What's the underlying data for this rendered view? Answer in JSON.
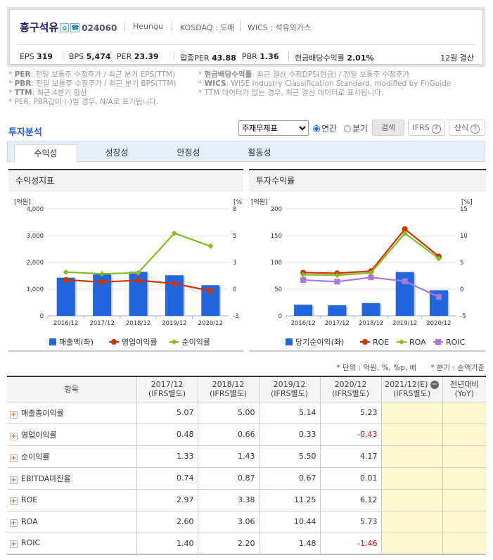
{
  "company": {
    "name": "흥구석유",
    "code": "024060",
    "eng": "Heungu",
    "market": "KOSDAQ : 도매",
    "wics": "WICS : 석유와가스",
    "icons": [
      "home-icon",
      "ir-icon"
    ]
  },
  "stats": [
    {
      "k": "EPS",
      "v": "319"
    },
    {
      "k": "BPS",
      "v": "5,474"
    },
    {
      "k": "PER",
      "v": "23.39"
    },
    {
      "k": "업종PER",
      "v": "43.88"
    },
    {
      "k": "PBR",
      "v": "1.36"
    },
    {
      "k": "현금배당수익률",
      "v": "2.01%"
    }
  ],
  "settle": "12월 결산",
  "notes_left": [
    {
      "k": "PER",
      "t": ": 전일 보통주 수정주가 / 최근 분기 EPS(TTM)"
    },
    {
      "k": "PBR",
      "t": ": 전일 보통주 수정주가 / 최근 분기 BPS(TTM)"
    },
    {
      "k": "TTM",
      "t": ": 최근 4분기 합산"
    },
    {
      "k": "",
      "t": "PER, PBR값이 (-)일 경우, N/A로 표기됩니다."
    }
  ],
  "notes_right": [
    {
      "k": "현금배당수익률",
      "t": ": 최근 결산 수정DPS(현금) / 전일 보통주 수정주가"
    },
    {
      "k": "WICS",
      "t": ": WISE Industry Classification Standard, modified by FnGuide"
    },
    {
      "k": "",
      "t": "TTM 데이터가 없는 경우, 최근 결산 데이터로 표시됩니다."
    }
  ],
  "section_title": "투자분석",
  "controls": {
    "select": "주재무제표",
    "annual": "연간",
    "quarter": "분기",
    "search": "검색",
    "ifrs": "IFRS",
    "formula": "산식",
    "q": "?"
  },
  "tabs": [
    "수익성",
    "성장성",
    "안정성",
    "활동성"
  ],
  "chart_data": [
    {
      "type": "bar+line",
      "title": "수익성지표",
      "left_unit": "[억원]",
      "right_unit": "[%]",
      "categories": [
        "2016/12",
        "2017/12",
        "2018/12",
        "2019/12",
        "2020/12"
      ],
      "ylim_left": [
        0,
        4000
      ],
      "left_ticks": [
        "0",
        "1,000",
        "2,000",
        "3,000",
        "4,000"
      ],
      "ylim_right": [
        -3,
        8
      ],
      "right_ticks": [
        "-3",
        "0",
        "3",
        "5",
        "8"
      ],
      "bars": {
        "name": "매출액(좌)",
        "color": "#2266dd",
        "values": [
          1430,
          1550,
          1650,
          1520,
          1150
        ]
      },
      "lines": [
        {
          "name": "영업이익률",
          "color": "#cc3300",
          "marker": "circle",
          "values": [
            0.7,
            0.48,
            0.66,
            0.33,
            -0.43
          ]
        },
        {
          "name": "순이익률",
          "color": "#88bb22",
          "marker": "diamond",
          "values": [
            1.5,
            1.33,
            1.43,
            5.5,
            4.17
          ]
        }
      ]
    },
    {
      "type": "bar+line",
      "title": "투자수익률",
      "left_unit": "[억원]",
      "right_unit": "[%]",
      "categories": [
        "2016/12",
        "2017/12",
        "2018/12",
        "2019/12",
        "2020/12"
      ],
      "ylim_left": [
        0,
        200
      ],
      "left_ticks": [
        "0",
        "50",
        "100",
        "150",
        "200"
      ],
      "ylim_right": [
        -5,
        15
      ],
      "right_ticks": [
        "-5",
        "0",
        "5",
        "10",
        "15"
      ],
      "bars": {
        "name": "당기순이익(좌)",
        "color": "#2266dd",
        "values": [
          21,
          20,
          24,
          82,
          48
        ]
      },
      "lines": [
        {
          "name": "ROE",
          "color": "#cc3300",
          "marker": "circle",
          "values": [
            3.1,
            2.97,
            3.38,
            11.25,
            6.12
          ]
        },
        {
          "name": "ROA",
          "color": "#88bb22",
          "marker": "diamond",
          "values": [
            2.7,
            2.6,
            3.06,
            10.44,
            5.73
          ]
        },
        {
          "name": "ROIC",
          "color": "#aa77dd",
          "marker": "square",
          "values": [
            1.7,
            1.4,
            2.2,
            1.48,
            -1.46
          ]
        }
      ]
    }
  ],
  "unit_note": "* 단위 : 억원, %, %p, 배      * 분기 : 순액기준",
  "table": {
    "headers": [
      {
        "a": "항목",
        "b": ""
      },
      {
        "a": "2017/12",
        "b": "(IFRS별도)"
      },
      {
        "a": "2018/12",
        "b": "(IFRS별도)"
      },
      {
        "a": "2019/12",
        "b": "(IFRS별도)"
      },
      {
        "a": "2020/12",
        "b": "(IFRS별도)"
      },
      {
        "a": "2021/12(E)",
        "b": "(IFRS별도)"
      },
      {
        "a": "전년대비",
        "b": "(YoY)"
      }
    ],
    "rows": [
      [
        "매출총이익률",
        "5.07",
        "5.00",
        "5.14",
        "5.23",
        "",
        ""
      ],
      [
        "영업이익률",
        "0.48",
        "0.66",
        "0.33",
        "-0.43",
        "",
        ""
      ],
      [
        "순이익률",
        "1.33",
        "1.43",
        "5.50",
        "4.17",
        "",
        ""
      ],
      [
        "EBITDA마진율",
        "0.74",
        "0.87",
        "0.67",
        "0.01",
        "",
        ""
      ],
      [
        "ROE",
        "2.97",
        "3.38",
        "11.25",
        "6.12",
        "",
        ""
      ],
      [
        "ROA",
        "2.60",
        "3.06",
        "10.44",
        "5.73",
        "",
        ""
      ],
      [
        "ROIC",
        "1.40",
        "2.20",
        "1.48",
        "-1.46",
        "",
        ""
      ]
    ]
  }
}
